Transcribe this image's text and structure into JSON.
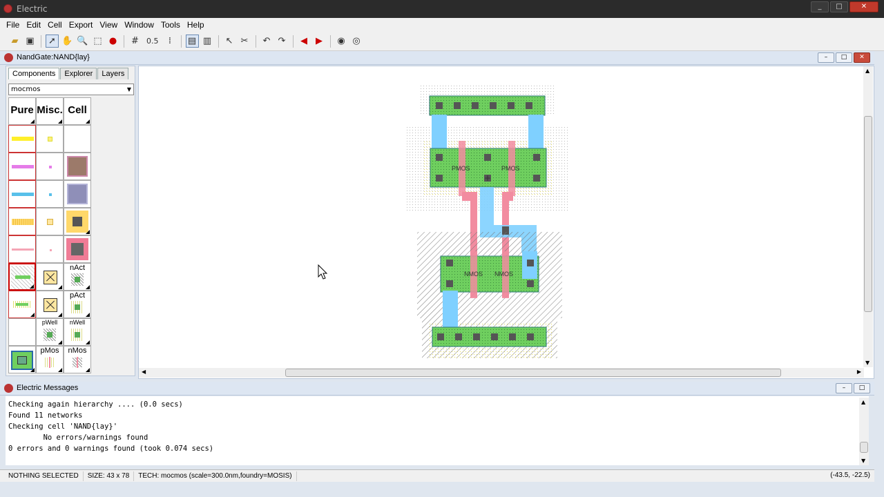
{
  "app": {
    "title": "Electric"
  },
  "menu": [
    "File",
    "Edit",
    "Cell",
    "Export",
    "View",
    "Window",
    "Tools",
    "Help"
  ],
  "toolbar": {
    "grid_value": "0.5"
  },
  "editor": {
    "title": "NandGate:NAND{lay}"
  },
  "left_panel": {
    "tabs": [
      "Components",
      "Explorer",
      "Layers"
    ],
    "technology": "mocmos",
    "headers": [
      "Pure",
      "Misc.",
      "Cell"
    ],
    "labels": {
      "nact": "nAct",
      "pact": "pAct",
      "pwell": "pWell",
      "nwell": "nWell",
      "pmos": "pMos",
      "nmos": "nMos"
    }
  },
  "layout": {
    "pmos_labels": [
      "PMOS",
      "PMOS"
    ],
    "nmos_labels": [
      "NMOS",
      "NMOS"
    ]
  },
  "messages_panel": {
    "title": "Electric Messages",
    "lines": [
      "Checking again hierarchy .... (0.0 secs)",
      "Found 11 networks",
      "Checking cell 'NAND{lay}'",
      "        No errors/warnings found",
      "0 errors and 0 warnings found (took 0.074 secs)"
    ]
  },
  "status": {
    "selection": "NOTHING SELECTED",
    "size": "SIZE: 43 x 78",
    "tech": "TECH: mocmos (scale=300.0nm,foundry=MOSIS)",
    "coords": "(-43.5, -22.5)"
  },
  "colors": {
    "metal1": "#7fd0ff",
    "poly": "#f28ca0",
    "active": "#6fcf5f",
    "contact": "#555555",
    "well_dots": "#d6cf6a"
  }
}
